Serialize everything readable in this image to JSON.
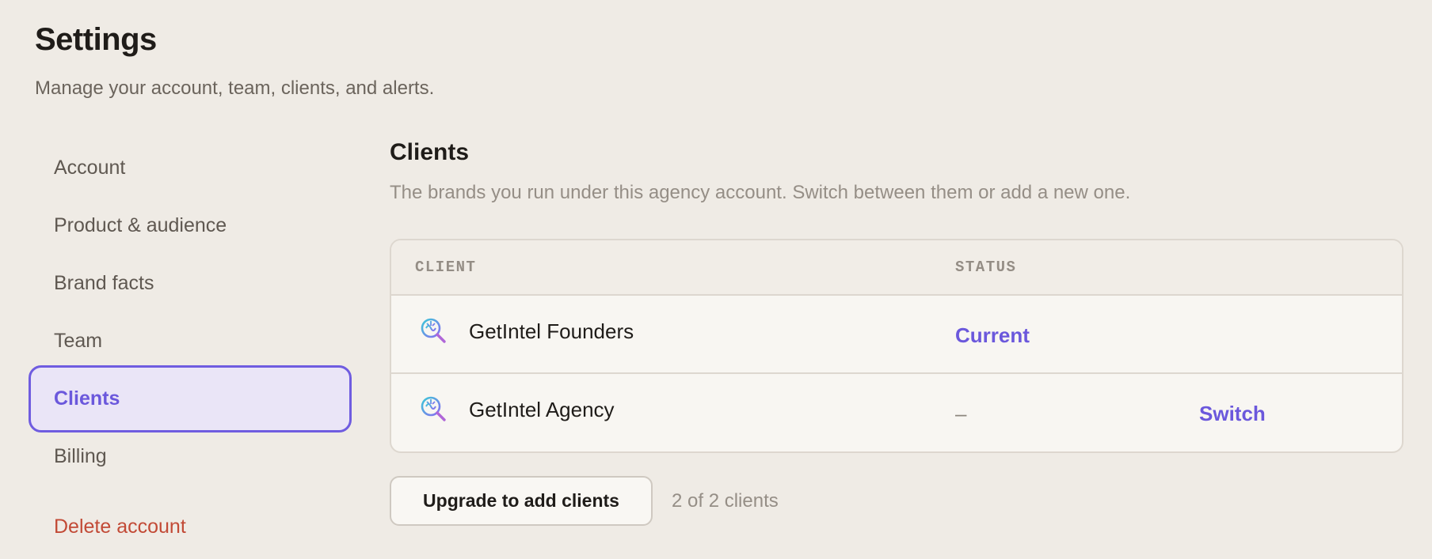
{
  "header": {
    "title": "Settings",
    "subtitle": "Manage your account, team, clients, and alerts."
  },
  "sidebar": {
    "items": [
      {
        "label": "Account"
      },
      {
        "label": "Product & audience"
      },
      {
        "label": "Brand facts"
      },
      {
        "label": "Team"
      },
      {
        "label": "Clients",
        "active": true
      },
      {
        "label": "Billing"
      }
    ],
    "delete_label": "Delete account"
  },
  "clients": {
    "title": "Clients",
    "description": "The brands you run under this agency account. Switch between them or add a new one.",
    "columns": [
      "CLIENT",
      "STATUS"
    ],
    "rows": [
      {
        "icon": "brain-search-icon",
        "name": "GetIntel Founders",
        "status": "Current",
        "action": ""
      },
      {
        "icon": "brain-search-icon",
        "name": "GetIntel Agency",
        "status": "–",
        "action": "Switch"
      }
    ],
    "upgrade_label": "Upgrade to add clients",
    "count_text": "2 of 2 clients"
  },
  "colors": {
    "accent": "#6b58dc",
    "danger": "#c24a36",
    "background": "#efebe5"
  }
}
